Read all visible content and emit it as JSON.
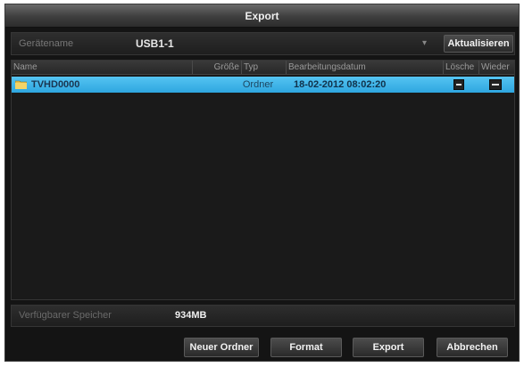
{
  "window": {
    "title": "Export"
  },
  "device": {
    "label": "Gerätename",
    "selected": "USB1-1",
    "refresh_label": "Aktualisieren"
  },
  "table": {
    "columns": [
      "Name",
      "Größe",
      "Typ",
      "Bearbeitungsdatum",
      "Lösche",
      "Wieder"
    ],
    "rows": [
      {
        "name": "TVHD0000",
        "size": "",
        "type": "Ordner",
        "date": "18-02-2012 08:02:20",
        "selected": true
      }
    ]
  },
  "storage": {
    "label": "Verfügbarer Speicher",
    "value": "934MB"
  },
  "footer": {
    "new_folder": "Neuer Ordner",
    "format": "Format",
    "export": "Export",
    "cancel": "Abbrechen"
  },
  "colors": {
    "selected_row": "#3bb4ea",
    "background": "#141414",
    "title_bar": "#4a4a4a"
  },
  "icons": {
    "folder": "folder-icon",
    "delete": "minus-icon",
    "play": "minus-icon",
    "dropdown": "chevron-down-icon"
  }
}
